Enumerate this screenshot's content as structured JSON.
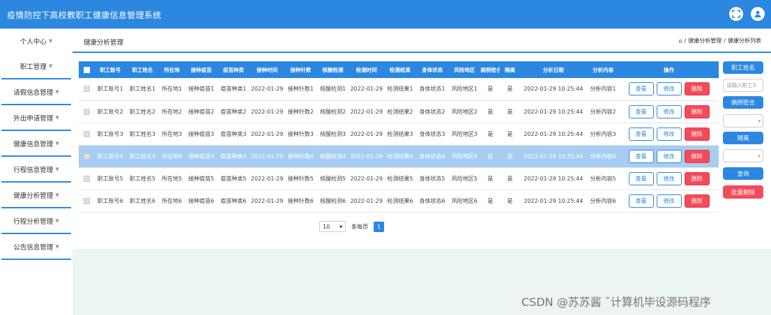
{
  "app": {
    "title": "疫情防控下高校教职工健康信息管理系统"
  },
  "sidebar": {
    "items": [
      {
        "label": "个人中心"
      },
      {
        "label": "职工管理"
      },
      {
        "label": "请假信息管理"
      },
      {
        "label": "外出申请管理"
      },
      {
        "label": "健康信息管理"
      },
      {
        "label": "行程信息管理"
      },
      {
        "label": "健康分析管理"
      },
      {
        "label": "行程分析管理"
      },
      {
        "label": "公告信息管理"
      }
    ]
  },
  "header": {
    "page_title": "健康分析管理",
    "breadcrumb": [
      "健康分析管理",
      "健康分析列表"
    ]
  },
  "table": {
    "columns": [
      "职工账号",
      "职工姓名",
      "所在地",
      "接种疫苗",
      "疫苗种类",
      "接种时间",
      "接种针数",
      "核酸检测",
      "检测时间",
      "检测结果",
      "身体状态",
      "风险地区",
      "病例密合",
      "隔离",
      "分析日期",
      "分析内容",
      "操作"
    ],
    "actions": {
      "view": "查看",
      "edit": "修改",
      "delete": "删除"
    },
    "rows": [
      [
        "职工账号1",
        "职工姓名1",
        "所在地1",
        "接种疫苗1",
        "疫苗种类1",
        "2022-01-29",
        "接种针数1",
        "核酸检测1",
        "2022-01-29",
        "检测结果1",
        "身体状态1",
        "风险地区1",
        "是",
        "是",
        "2022-01-29 10:25:44",
        "分析内容1"
      ],
      [
        "职工账号2",
        "职工姓名2",
        "所在地2",
        "接种疫苗2",
        "疫苗种类2",
        "2022-01-29",
        "接种针数2",
        "核酸检测2",
        "2022-01-29",
        "检测结果2",
        "身体状态2",
        "风险地区2",
        "是",
        "是",
        "2022-01-29 10:25:44",
        "分析内容2"
      ],
      [
        "职工账号3",
        "职工姓名3",
        "所在地3",
        "接种疫苗3",
        "疫苗种类3",
        "2022-01-29",
        "接种针数3",
        "核酸检测3",
        "2022-01-29",
        "检测结果3",
        "身体状态3",
        "风险地区3",
        "是",
        "是",
        "2022-01-29 10:25:44",
        "分析内容3"
      ],
      [
        "职工账号4",
        "职工姓名4",
        "所在地4",
        "接种疫苗4",
        "疫苗种类4",
        "2022-01-29",
        "接种针数4",
        "核酸检测4",
        "2022-01-29",
        "检测结果4",
        "身体状态4",
        "风险地区4",
        "是",
        "是",
        "2022-01-29 10:25:44",
        "分析内容4"
      ],
      [
        "职工账号5",
        "职工姓名5",
        "所在地5",
        "接种疫苗5",
        "疫苗种类5",
        "2022-01-29",
        "接种针数5",
        "核酸检测5",
        "2022-01-29",
        "检测结果5",
        "身体状态5",
        "风险地区5",
        "是",
        "是",
        "2022-01-29 10:25:44",
        "分析内容5"
      ],
      [
        "职工账号6",
        "职工姓名6",
        "所在地6",
        "接种疫苗6",
        "疫苗种类6",
        "2022-01-29",
        "接种针数6",
        "核酸检测6",
        "2022-01-29",
        "检测结果6",
        "身体状态6",
        "风险地区6",
        "是",
        "是",
        "2022-01-29 10:25:44",
        "分析内容6"
      ]
    ]
  },
  "pagination": {
    "page_size": "10",
    "page_size_label": "条每页",
    "current_page": "1"
  },
  "right_panel": {
    "name_button": "职工姓名",
    "name_placeholder": "请输入职工3",
    "case_contact_button": "病例密合",
    "quarantine_button": "隔离",
    "search_button": "查询",
    "batch_delete_button": "批量删除"
  },
  "watermark": "CSDN @苏苏酱   ˇ计算机毕设源码程序",
  "colors": {
    "primary": "#2b87e0",
    "danger": "#f24c5a",
    "selected_row": "#a7cdf2"
  }
}
